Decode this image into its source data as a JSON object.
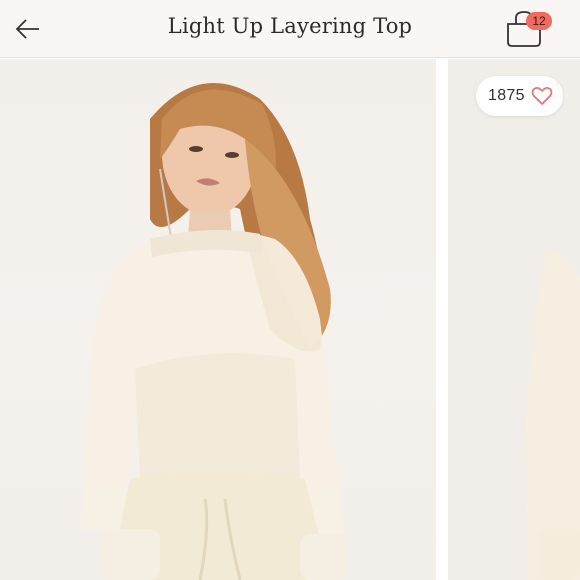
{
  "header": {
    "title": "Light Up Layering Top",
    "back_icon": "arrow-left-icon",
    "bag_icon": "shopping-bag-icon",
    "bag_count": "12",
    "badge_color": "#f06a5f"
  },
  "gallery": {
    "like_count": "1875",
    "like_icon": "heart-outline-icon",
    "heart_color": "#e5736b",
    "images": [
      {
        "alt": "product-photo-front"
      },
      {
        "alt": "product-photo-next"
      }
    ]
  }
}
